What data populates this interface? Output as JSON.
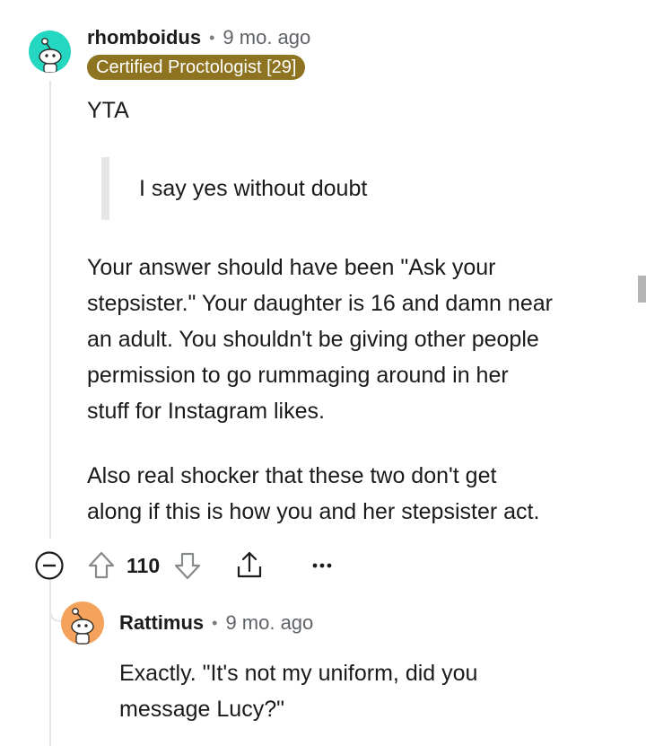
{
  "comment": {
    "username": "rhomboidus",
    "age": "9 mo. ago",
    "flair": "Certified Proctologist [29]",
    "verdict": "YTA",
    "quote": "I say yes without doubt",
    "paragraph1_lines": [
      "Your answer should have been \"Ask your",
      "stepsister.\" Your daughter is 16 and damn near",
      "an adult. You shouldn't be giving other people",
      "permission to go rummaging around in her",
      "stuff for Instagram likes."
    ],
    "paragraph2_lines": [
      "Also real shocker that these two don't get",
      "along if this is how you and her stepsister act."
    ],
    "score": "110",
    "avatar_color": "#24d7c0"
  },
  "reply": {
    "username": "Rattimus",
    "age": "9 mo. ago",
    "body_lines": [
      "Exactly. \"It's not my uniform, did you",
      "message Lucy?\""
    ],
    "avatar_color": "#f5a35c"
  },
  "icons": {
    "collapse": "minus-circle-icon",
    "upvote": "upvote-arrow-icon",
    "downvote": "downvote-arrow-icon",
    "share": "share-icon",
    "more": "more-dots-icon"
  }
}
